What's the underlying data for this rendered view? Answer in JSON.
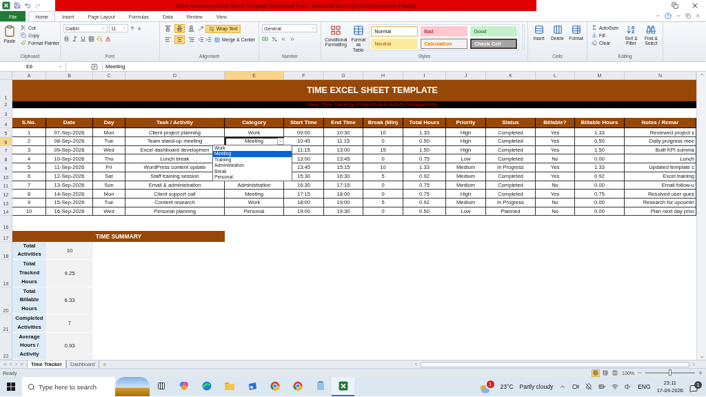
{
  "window": {
    "title": "Store Inventory Excel Sheet Template Download Free  -  Microsoft Excel (Product Activation Failed)"
  },
  "ribbon_tabs": [
    {
      "label": "File",
      "kind": "file",
      "selected": false
    },
    {
      "label": "Home",
      "kind": "tab",
      "selected": true
    },
    {
      "label": "Insert",
      "kind": "tab",
      "selected": false
    },
    {
      "label": "Page Layout",
      "kind": "tab",
      "selected": false
    },
    {
      "label": "Formulas",
      "kind": "tab",
      "selected": false
    },
    {
      "label": "Data",
      "kind": "tab",
      "selected": false
    },
    {
      "label": "Review",
      "kind": "tab",
      "selected": false
    },
    {
      "label": "View",
      "kind": "tab",
      "selected": false
    }
  ],
  "ribbon": {
    "clipboard": {
      "label": "Clipboard",
      "paste": "Paste",
      "cut": "Cut",
      "copy": "Copy",
      "format_painter": "Format Painter"
    },
    "font": {
      "label": "Font",
      "name": "Calibri",
      "size": "11"
    },
    "alignment": {
      "label": "Alignment",
      "vertical": [
        {
          "selected": false
        },
        {
          "selected": true
        },
        {
          "selected": false
        }
      ],
      "horizontal": [
        {
          "selected": false
        },
        {
          "selected": true
        },
        {
          "selected": false
        }
      ],
      "wrap_text": {
        "label": "Wrap Text",
        "selected": true
      },
      "merge": "Merge & Center"
    },
    "number": {
      "label": "Number",
      "format": "General"
    },
    "styles": {
      "label": "Styles",
      "conditional": "Conditional Formatting",
      "format_table": "Format as Table",
      "cells": [
        {
          "label": "Normal",
          "kind": "normal"
        },
        {
          "label": "Bad",
          "kind": "bad"
        },
        {
          "label": "Good",
          "kind": "good"
        },
        {
          "label": "Neutral",
          "kind": "neutral"
        },
        {
          "label": "Calculation",
          "kind": "calculation"
        },
        {
          "label": "Check Cell",
          "kind": "check"
        }
      ]
    },
    "cells": {
      "label": "Cells",
      "buttons": [
        "Insert",
        "Delete",
        "Format"
      ]
    },
    "editing": {
      "label": "Editing",
      "autosum": "AutoSum",
      "fill": "Fill",
      "clear": "Clear",
      "sort": "Sort & Filter",
      "find": "Find & Select"
    }
  },
  "formula_bar": {
    "name_box": "E6",
    "value": "Meeting"
  },
  "sheet": {
    "columns": [
      {
        "label": "A",
        "selected": false
      },
      {
        "label": "B",
        "selected": false
      },
      {
        "label": "C",
        "selected": false
      },
      {
        "label": "D",
        "selected": false
      },
      {
        "label": "E",
        "selected": true
      },
      {
        "label": "F",
        "selected": false
      },
      {
        "label": "G",
        "selected": false
      },
      {
        "label": "H",
        "selected": false
      },
      {
        "label": "I",
        "selected": false
      },
      {
        "label": "J",
        "selected": false
      },
      {
        "label": "K",
        "selected": false
      },
      {
        "label": "L",
        "selected": false
      },
      {
        "label": "M",
        "selected": false
      },
      {
        "label": "N",
        "selected": false
      }
    ],
    "rows": [
      {
        "number": "1",
        "kind": "title",
        "text": "TIME EXCEL SHEET TEMPLATE"
      },
      {
        "number": "2",
        "kind": "subtitle",
        "text": "Daily Time Tracking, Productivity & Activity Management"
      },
      {
        "number": "3",
        "kind": "blank"
      },
      {
        "number": "4",
        "kind": "header",
        "cells": [
          "S.No.",
          "Date",
          "Day",
          "Task / Activity",
          "Category",
          "Start Time",
          "End Time",
          "Break (Min)",
          "Total Hours",
          "Priority",
          "Status",
          "Billable?",
          "Billable Hours",
          "Notes / Remar"
        ]
      },
      {
        "number": "5",
        "kind": "data",
        "selected": false,
        "cells": [
          "1",
          "07-Sep-2026",
          "Mon",
          "Client project planning",
          "Work",
          "09:00",
          "10:30",
          "10",
          "1.33",
          "High",
          "Completed",
          "Yes",
          "1.33",
          "Reviewed project s"
        ]
      },
      {
        "number": "6",
        "kind": "data",
        "selected": true,
        "cells": [
          "2",
          "08-Sep-2026",
          "Tue",
          "Team stand-up meeting",
          "Meeting",
          "10:45",
          "11:15",
          "0",
          "0.50",
          "High",
          "Completed",
          "Yes",
          "0.50",
          "Daily progress mee"
        ]
      },
      {
        "number": "7",
        "kind": "data",
        "selected": false,
        "cells": [
          "3",
          "09-Sep-2026",
          "Wed",
          "Excel dashboard developmen",
          null,
          "11:15",
          "13:00",
          "15",
          "1.50",
          "High",
          "Completed",
          "Yes",
          "1.50",
          "Built KPI summa"
        ]
      },
      {
        "number": "8",
        "kind": "data",
        "selected": false,
        "cells": [
          "4",
          "10-Sep-2026",
          "Thu",
          "Lunch break",
          null,
          "13:00",
          "13:45",
          "0",
          "0.75",
          "Low",
          "Completed",
          "No",
          "0.00",
          "Lunch"
        ]
      },
      {
        "number": "9",
        "kind": "data",
        "selected": false,
        "cells": [
          "5",
          "11-Sep-2026",
          "Fri",
          "WordPress content update",
          null,
          "13:45",
          "15:15",
          "10",
          "1.33",
          "Medium",
          "In Progress",
          "Yes",
          "1.33",
          "Updated template c"
        ]
      },
      {
        "number": "10",
        "kind": "data",
        "selected": false,
        "cells": [
          "6",
          "12-Sep-2026",
          "Sat",
          "Staff training session",
          null,
          "15:30",
          "16:30",
          "5",
          "0.92",
          "Medium",
          "Completed",
          "Yes",
          "0.92",
          "Excel training"
        ]
      },
      {
        "number": "11",
        "kind": "data",
        "selected": false,
        "cells": [
          "7",
          "13-Sep-2026",
          "Sun",
          "Email & administration",
          "Administration",
          "16:30",
          "17:15",
          "0",
          "0.75",
          "Medium",
          "Completed",
          "No",
          "0.00",
          "Email follow-u"
        ]
      },
      {
        "number": "12",
        "kind": "data",
        "selected": false,
        "cells": [
          "8",
          "14-Sep-2026",
          "Mon",
          "Client support call",
          "Meeting",
          "17:15",
          "18:00",
          "0",
          "0.75",
          "High",
          "Completed",
          "Yes",
          "0.75",
          "Resolved user ques"
        ]
      },
      {
        "number": "13",
        "kind": "data",
        "selected": false,
        "cells": [
          "9",
          "15-Sep-2026",
          "Tue",
          "Content research",
          "Work",
          "18:00",
          "19:00",
          "5",
          "0.92",
          "Medium",
          "In Progress",
          "No",
          "0.00",
          "Research for upcomin"
        ]
      },
      {
        "number": "14",
        "kind": "data",
        "selected": false,
        "cells": [
          "10",
          "16-Sep-2026",
          "Wed",
          "Personal planning",
          "Personal",
          "19:00",
          "19:30",
          "0",
          "0.50",
          "Low",
          "Planned",
          "No",
          "0.00",
          "Plan next day prior"
        ]
      },
      {
        "number": "16",
        "kind": "blank"
      },
      {
        "number": "17",
        "kind": "section",
        "heading": "TIME SUMMARY"
      },
      {
        "number": "18",
        "kind": "summary",
        "label": "Total Activities",
        "value": "10"
      },
      {
        "number": "19",
        "kind": "summary",
        "label": "Total Tracked Hours",
        "value": "9.25"
      },
      {
        "number": "20",
        "kind": "summary",
        "label": "Total Billable Hours",
        "value": "6.33"
      },
      {
        "number": "21",
        "kind": "summary",
        "label": "Completed Activities",
        "value": "7"
      },
      {
        "number": "22",
        "kind": "summary",
        "label": "Average Hours / Activity",
        "value": "0.93"
      }
    ],
    "validation_list": [
      {
        "label": "Work",
        "selected": false
      },
      {
        "label": "Meeting",
        "selected": true
      },
      {
        "label": "Training",
        "selected": false
      },
      {
        "label": "Administration",
        "selected": false
      },
      {
        "label": "Break",
        "selected": false
      },
      {
        "label": "Personal",
        "selected": false
      }
    ]
  },
  "sheet_tabs": [
    {
      "label": "Time Tracker",
      "selected": true
    },
    {
      "label": "Dashboard",
      "selected": false
    }
  ],
  "status_bar": {
    "status": "Ready",
    "zoom": "100%",
    "zoom_slider": {
      "level": 0.5
    }
  },
  "taskbar": {
    "search": {
      "placeholder": "Type here to search"
    },
    "weather": {
      "badge": "1",
      "temperature": "23°C",
      "condition": "Partly cloudy"
    },
    "language": "ENG",
    "time": "23:11",
    "date": "17-09-2026",
    "notification_badge": "1"
  }
}
